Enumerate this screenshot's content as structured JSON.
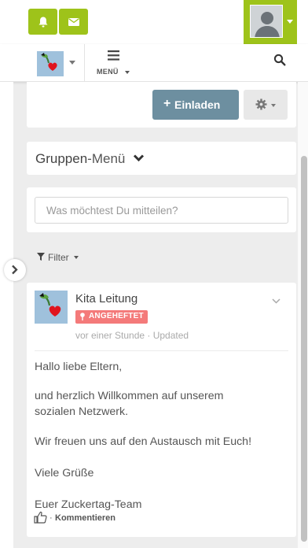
{
  "colors": {
    "brand_green": "#9ec31a",
    "invite_button": "#6d8fa0",
    "pinned_badge": "#f47a7a",
    "page_background": "#ededed"
  },
  "topbar": {
    "notifications_icon": "bell-icon",
    "messages_icon": "envelope-icon",
    "profile_icon": "user-avatar-icon"
  },
  "navbar": {
    "space_icon": "space-logo-icon",
    "menu_label": "MENÜ",
    "search_icon": "search-icon"
  },
  "actions": {
    "invite_label": "Einladen",
    "settings_icon": "gear-icon"
  },
  "group_menu": {
    "title_bold": "Gruppen",
    "title_rest": "-Menü"
  },
  "share": {
    "placeholder": "Was möchtest Du mitteilen?"
  },
  "filter": {
    "label": "Filter"
  },
  "post": {
    "author": "Kita Leitung",
    "badge": "ANGEHEFTET",
    "meta": "vor einer Stunde · Updated",
    "paragraphs": [
      "Hallo liebe Eltern,",
      "und herzlich Willkommen auf unserem sozialen Netzwerk.",
      "Wir freuen uns auf den Austausch mit Euch!",
      "Viele Grüße",
      "Euer Zuckertag-Team"
    ],
    "separator": "·",
    "comment_label": "Kommentieren"
  }
}
